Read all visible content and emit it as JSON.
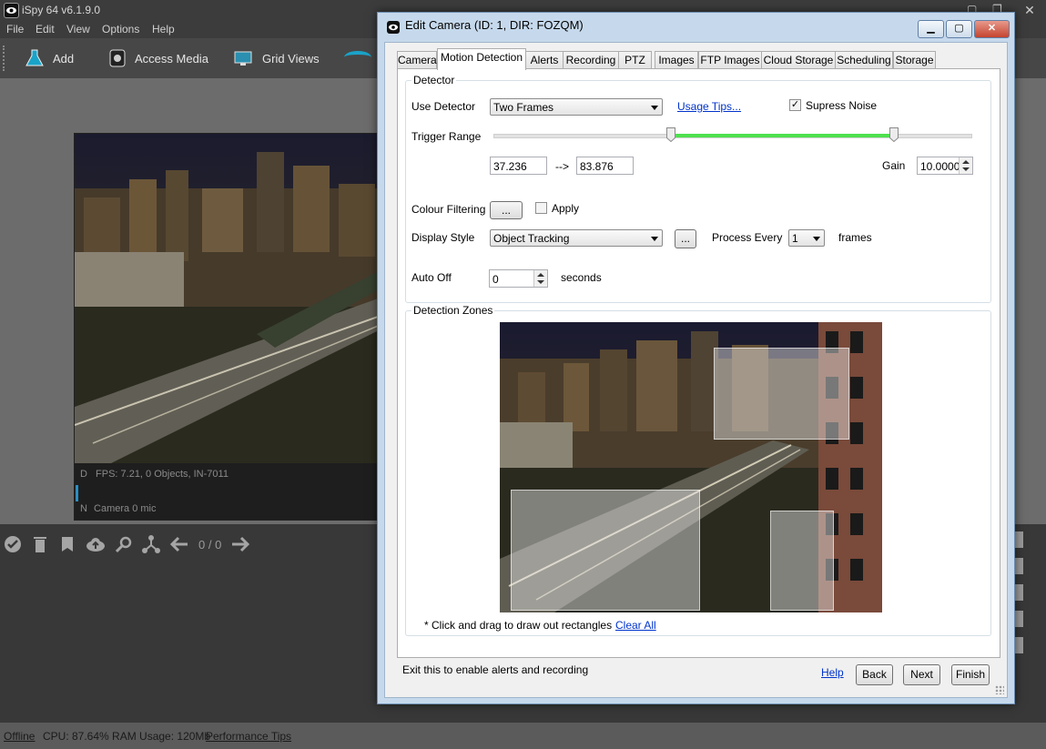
{
  "app": {
    "title": "iSpy 64 v6.1.9.0",
    "menu": [
      "File",
      "Edit",
      "View",
      "Options",
      "Help"
    ],
    "toolbar": [
      {
        "label": "Add",
        "icon": "add-flask-icon"
      },
      {
        "label": "Access Media",
        "icon": "media-icon"
      },
      {
        "label": "Grid Views",
        "icon": "grid-views-icon"
      }
    ]
  },
  "camera_tile": {
    "info_line": "FPS: 7.21, 0 Objects, IN-7011",
    "info_prefix": "D",
    "bottom_line": "Camera 0 mic",
    "bottom_prefix": "N"
  },
  "media_toolbar": {
    "icons": [
      "check-icon",
      "trash-icon",
      "bookmark-icon",
      "cloud-upload-icon",
      "search-icon",
      "share-icon",
      "arrow-left-icon",
      "arrow-right-icon"
    ],
    "page_counter": "0 / 0"
  },
  "statusbar": {
    "offline_link": "Offline",
    "stats": "CPU: 87.64% RAM Usage: 120Mb",
    "perf_link": "Performance Tips"
  },
  "dialog": {
    "title": "Edit Camera (ID: 1, DIR: FOZQM)",
    "tabs": [
      "Camera",
      "Motion Detection",
      "Alerts",
      "Recording",
      "PTZ",
      "Images",
      "FTP Images",
      "Cloud Storage",
      "Scheduling",
      "Storage"
    ],
    "active_tab": "Motion Detection",
    "detector": {
      "group_title": "Detector",
      "use_detector_label": "Use Detector",
      "use_detector_value": "Two Frames",
      "usage_tips_link": "Usage Tips...",
      "suppress_noise_label": "Supress Noise",
      "suppress_noise_checked": true,
      "trigger_range_label": "Trigger Range",
      "trigger_min": "37.236",
      "trigger_arrow": "-->",
      "trigger_max": "83.876",
      "trigger_min_fraction": 0.37236,
      "trigger_max_fraction": 0.83876,
      "gain_label": "Gain",
      "gain_value": "10.00000",
      "colour_filtering_label": "Colour Filtering",
      "colour_filtering_button": "...",
      "apply_label": "Apply",
      "apply_checked": false,
      "display_style_label": "Display Style",
      "display_style_value": "Object Tracking",
      "display_style_button": "...",
      "process_every_label": "Process Every",
      "process_every_value": "1",
      "frames_label": "frames",
      "auto_off_label": "Auto Off",
      "auto_off_value": "0",
      "seconds_label": "seconds"
    },
    "zones": {
      "group_title": "Detection Zones",
      "hint": "* Click and drag to draw out rectangles",
      "clear_all_link": "Clear All"
    },
    "footer": {
      "hint": "Exit this to enable alerts and recording",
      "help_link": "Help",
      "back_button": "Back",
      "next_button": "Next",
      "finish_button": "Finish"
    },
    "colors": {
      "range_fill": "#4ee04e",
      "link": "#0033cc"
    }
  }
}
